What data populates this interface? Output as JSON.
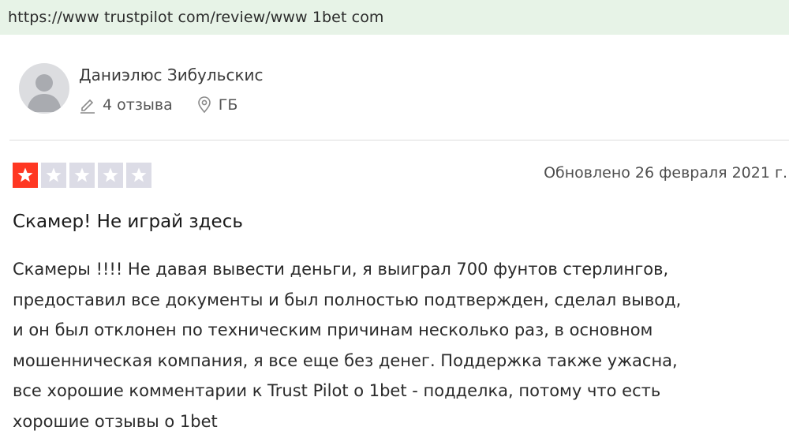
{
  "browser": {
    "url": "https://www trustpilot com/review/www 1bet com"
  },
  "reviewer": {
    "name": "Даниэлюс Зибульскис",
    "review_count": "4 отзыва",
    "country": "ГБ",
    "avatar_icon": "user-avatar-icon",
    "reviews_icon": "pencil-icon",
    "location_icon": "location-pin-icon"
  },
  "review": {
    "rating": 1,
    "max_rating": 5,
    "date": "Обновлено 26 февраля 2021 г.",
    "title": "Скамер! Не играй здесь",
    "body_lines": [
      "Скамеры !!!! Не давая вывести деньги, я выиграл 700 фунтов стерлингов,",
      "предоставил все документы и был полностью подтвержден, сделал вывод,",
      "и он был отклонен по техническим причинам несколько раз, в основном",
      "мошенническая компания, я все еще без денег. Поддержка также ужасна,",
      "все хорошие комментарии к Trust Pilot о 1bet - подделка, потому что есть",
      "хорошие отзывы о 1bet"
    ]
  },
  "colors": {
    "url_bar_bg": "#e7f3e7",
    "star_filled": "#ff3722",
    "star_empty": "#dcdce6",
    "avatar_bg": "#dcdde0"
  }
}
